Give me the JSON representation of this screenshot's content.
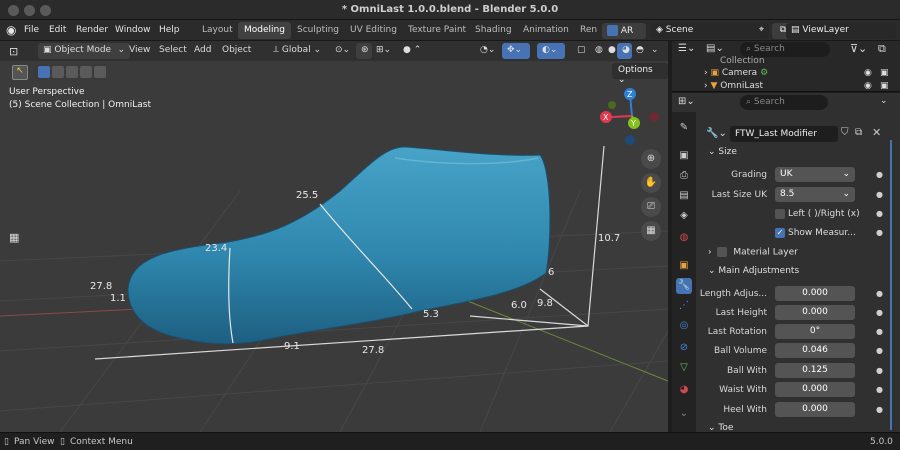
{
  "window": {
    "title": "* OmniLast 1.0.0.blend - Blender 5.0.0"
  },
  "menu": {
    "items": [
      "File",
      "Edit",
      "Render",
      "Window",
      "Help"
    ]
  },
  "workspaces": [
    "Layout",
    "Modeling",
    "Sculpting",
    "UV Editing",
    "Texture Paint",
    "Shading",
    "Animation",
    "Ren"
  ],
  "active_workspace": "Modeling",
  "topright": {
    "ar_label": "AR",
    "scene": "Scene",
    "view_layer": "ViewLayer"
  },
  "viewport_header": {
    "mode": "Object Mode",
    "menus": [
      "View",
      "Select",
      "Add",
      "Object"
    ],
    "orientation": "Global",
    "options_label": "Options"
  },
  "viewport": {
    "perspective_label": "User Perspective",
    "collection_label": "(5) Scene Collection | OmniLast",
    "gizmo": {
      "z": "Z",
      "y": "Y",
      "x": "X"
    },
    "measurements": {
      "m1": "25.5",
      "m2": "23.4",
      "m3": "27.8",
      "m4": "1.1",
      "m5": "9.1",
      "m6": "27.8",
      "m7": "5.3",
      "m8": "6.0",
      "m9": "9.8",
      "m10": "10.7",
      "m11": "6"
    }
  },
  "outliner": {
    "search_placeholder": "Search",
    "collection": "Collection",
    "items": [
      {
        "name": "Camera"
      },
      {
        "name": "OmniLast"
      }
    ]
  },
  "properties": {
    "search_placeholder": "Search",
    "modifier_name": "FTW_Last Modifier",
    "sections": {
      "size": "Size",
      "material_layer": "Material Layer",
      "main_adjustments": "Main Adjustments",
      "toe": "Toe"
    },
    "size": {
      "grading_label": "Grading",
      "grading_value": "UK",
      "last_size_label": "Last Size UK",
      "last_size_value": "8.5",
      "left_right_label": "Left ( )/Right (x)",
      "show_measure_label": "Show Measur..."
    },
    "adjustments": [
      {
        "label": "Length Adjus...",
        "value": "0.000"
      },
      {
        "label": "Last Height",
        "value": "0.000"
      },
      {
        "label": "Last Rotation",
        "value": "0°"
      },
      {
        "label": "Ball Volume",
        "value": "0.046"
      },
      {
        "label": "Ball With",
        "value": "0.125"
      },
      {
        "label": "Waist With",
        "value": "0.000"
      },
      {
        "label": "Heel With",
        "value": "0.000"
      }
    ]
  },
  "status": {
    "pan_view": "Pan View",
    "context_menu": "Context Menu",
    "version": "5.0.0"
  },
  "colors": {
    "accent": "#4772b3",
    "last_blue": "#2f87ad",
    "x_axis": "#e2394d",
    "y_axis": "#84c21b",
    "z_axis": "#2f7fd4"
  }
}
